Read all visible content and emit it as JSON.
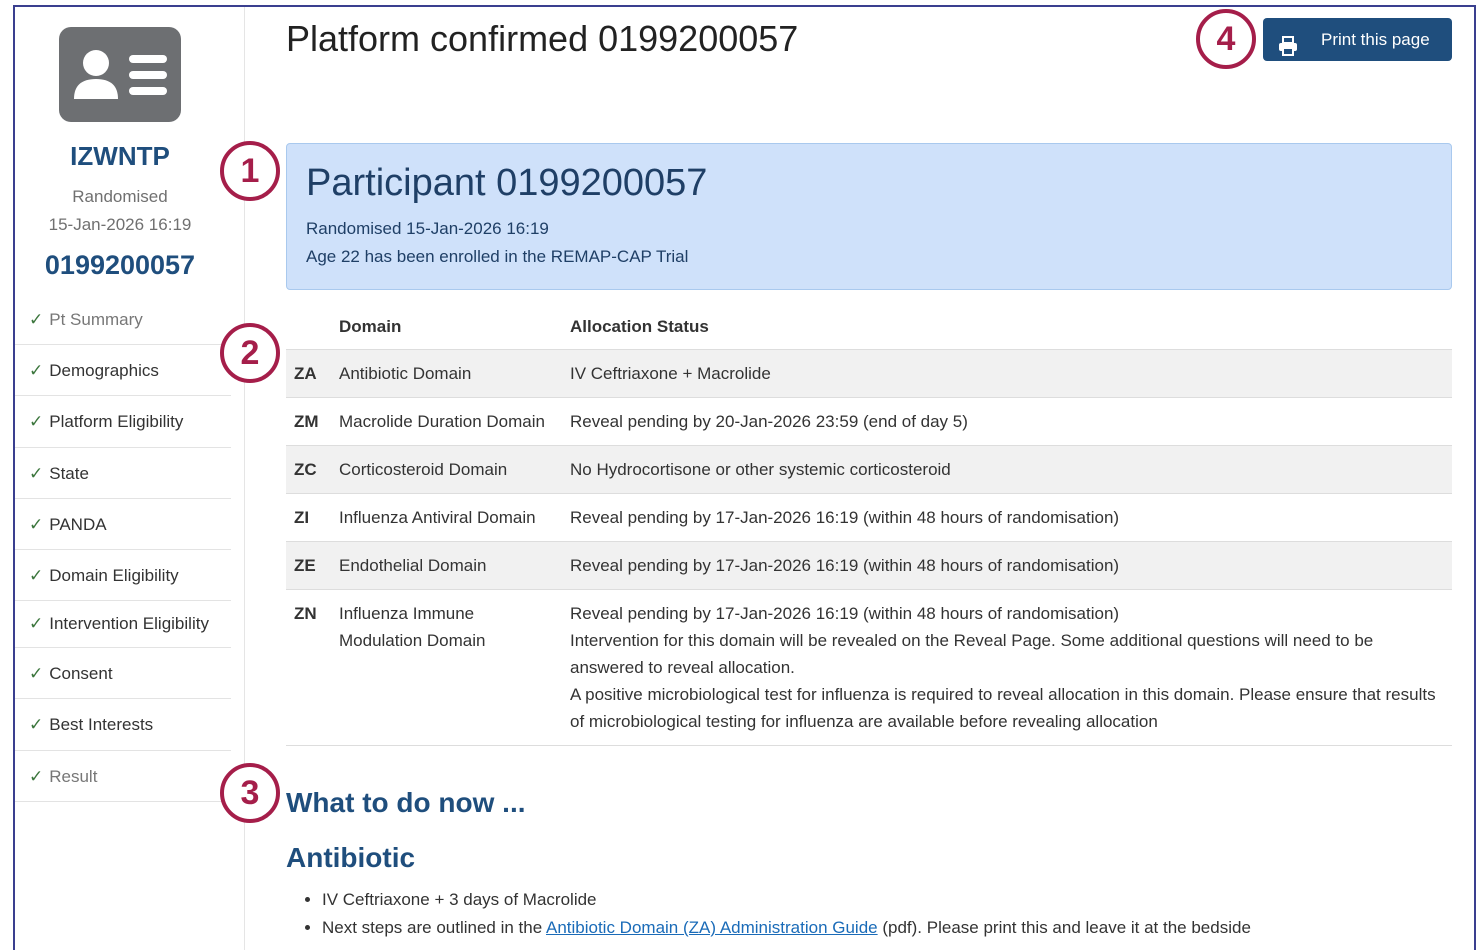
{
  "sidebar": {
    "participant_code": "IZWNTP",
    "status": "Randomised",
    "datetime": "15-Jan-2026 16:19",
    "participant_number": "0199200057",
    "avatar_icon": "contact-card-icon",
    "items": [
      {
        "label": "Pt Summary"
      },
      {
        "label": "Demographics"
      },
      {
        "label": "Platform Eligibility"
      },
      {
        "label": "State"
      },
      {
        "label": "PANDA"
      },
      {
        "label": "Domain Eligibility"
      },
      {
        "label": "Intervention Eligibility"
      },
      {
        "label": "Consent"
      },
      {
        "label": "Best Interests"
      },
      {
        "label": "Result"
      }
    ]
  },
  "header": {
    "title": "Platform confirmed 0199200057",
    "print_label": "Print this page",
    "print_icon": "printer-icon"
  },
  "callout": {
    "title": "Participant 0199200057",
    "line1": "Randomised 15-Jan-2026 16:19",
    "line2": "Age 22 has been enrolled in the REMAP-CAP Trial"
  },
  "table": {
    "headers": [
      "",
      "Domain",
      "Allocation Status"
    ],
    "rows": [
      {
        "code": "ZA",
        "domain": "Antibiotic Domain",
        "status": [
          "IV Ceftriaxone + Macrolide"
        ]
      },
      {
        "code": "ZM",
        "domain": "Macrolide Duration Domain",
        "status": [
          "Reveal pending by 20-Jan-2026 23:59 (end of day 5)"
        ]
      },
      {
        "code": "ZC",
        "domain": "Corticosteroid Domain",
        "status": [
          "No Hydrocortisone or other systemic corticosteroid"
        ]
      },
      {
        "code": "ZI",
        "domain": "Influenza Antiviral Domain",
        "status": [
          "Reveal pending by 17-Jan-2026 16:19 (within 48 hours of randomisation)"
        ]
      },
      {
        "code": "ZE",
        "domain": "Endothelial Domain",
        "status": [
          "Reveal pending by 17-Jan-2026 16:19 (within 48 hours of randomisation)"
        ]
      },
      {
        "code": "ZN",
        "domain": "Influenza Immune Modulation Domain",
        "status": [
          "Reveal pending by 17-Jan-2026 16:19 (within 48 hours of randomisation)",
          "Intervention for this domain will be revealed on the Reveal Page. Some additional questions will need to be answered to reveal allocation.",
          "A positive microbiological test for influenza is required to reveal allocation in this domain. Please ensure that results of microbiological testing for influenza are available before revealing allocation"
        ]
      }
    ]
  },
  "next": {
    "heading": "What to do now ...",
    "subheading": "Antibiotic",
    "bullet1": "IV Ceftriaxone + 3 days of Macrolide",
    "bullet2_pre": "Next steps are outlined in the ",
    "bullet2_link": "Antibiotic Domain (ZA) Administration Guide",
    "bullet2_post": " (pdf). Please print this and leave it at the bedside"
  },
  "badges": [
    "1",
    "2",
    "3",
    "4"
  ],
  "colors": {
    "brand": "#1f4e7d",
    "callout_bg": "#cfe1fa",
    "badge": "#a51e4a",
    "check": "#3c763d"
  }
}
